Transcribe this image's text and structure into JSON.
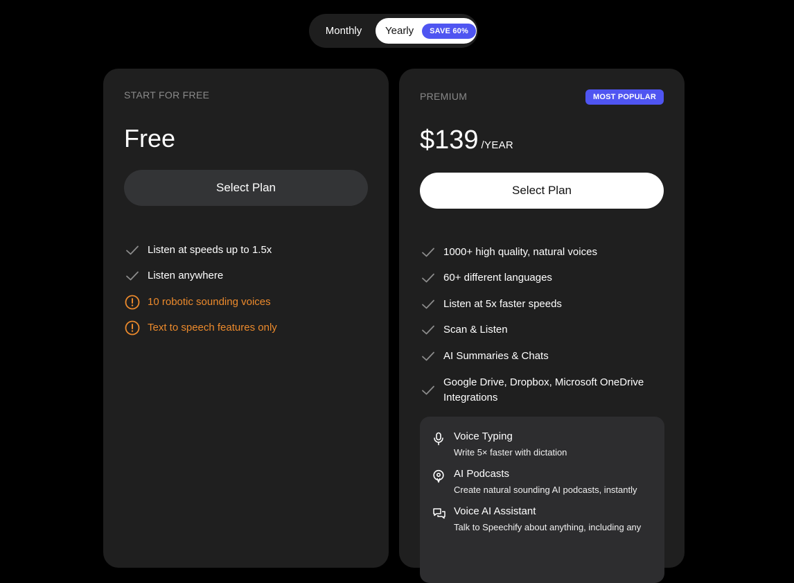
{
  "billing_toggle": {
    "monthly_label": "Monthly",
    "yearly_label": "Yearly",
    "save_badge": "SAVE 60%",
    "selected": "Yearly"
  },
  "free_plan": {
    "eyebrow": "START FOR FREE",
    "price": "Free",
    "button_label": "Select Plan",
    "features": [
      {
        "text": "Listen at speeds up to 1.5x",
        "icon": "check-icon"
      },
      {
        "text": "Listen anywhere",
        "icon": "check-icon"
      },
      {
        "text": "10 robotic sounding voices",
        "icon": "warning-icon"
      },
      {
        "text": "Text to speech features only",
        "icon": "warning-icon"
      }
    ]
  },
  "premium_plan": {
    "eyebrow": "PREMIUM",
    "badge": "MOST POPULAR",
    "price": "$139",
    "period": "/YEAR",
    "button_label": "Select Plan",
    "features": [
      {
        "text": "1000+ high quality, natural voices",
        "icon": "check-icon"
      },
      {
        "text": "60+ different languages",
        "icon": "check-icon"
      },
      {
        "text": "Listen at 5x faster speeds",
        "icon": "check-icon"
      },
      {
        "text": "Scan & Listen",
        "icon": "check-icon"
      },
      {
        "text": "AI Summaries & Chats",
        "icon": "check-icon"
      },
      {
        "text": "Google Drive, Dropbox, Microsoft OneDrive Integrations",
        "icon": "check-icon"
      }
    ],
    "addons": [
      {
        "title": "Voice Typing",
        "desc": "Write 5× faster with dictation",
        "icon": "microphone-icon"
      },
      {
        "title": "AI Podcasts",
        "desc": "Create natural sounding AI podcasts, instantly",
        "icon": "podcast-icon"
      },
      {
        "title": "Voice AI Assistant",
        "desc": "Talk to Speechify about anything, including any",
        "icon": "chat-bubbles-icon"
      }
    ]
  },
  "colors": {
    "accent": "#4f55f1",
    "warning": "#ec8a2c",
    "card_bg": "#1f1f1f",
    "page_bg": "#000000"
  }
}
